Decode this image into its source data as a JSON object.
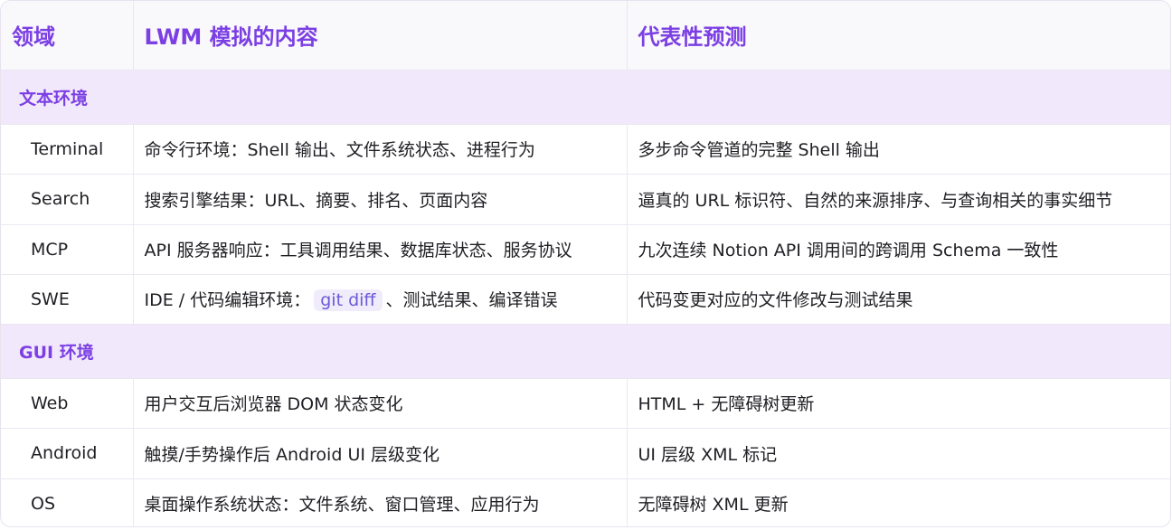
{
  "header": {
    "col1": "领域",
    "col2": "LWM 模拟的内容",
    "col3": "代表性预测"
  },
  "groups": [
    {
      "label": "文本环境",
      "rows": [
        {
          "domain": "Terminal",
          "simulates": "命令行环境：Shell 输出、文件系统状态、进程行为",
          "prediction": "多步命令管道的完整 Shell 输出"
        },
        {
          "domain": "Search",
          "simulates": "搜索引擎结果：URL、摘要、排名、页面内容",
          "prediction": "逼真的 URL 标识符、自然的来源排序、与查询相关的事实细节"
        },
        {
          "domain": "MCP",
          "simulates": "API 服务器响应：工具调用结果、数据库状态、服务协议",
          "prediction": "九次连续 Notion API 调用间的跨调用 Schema 一致性"
        },
        {
          "domain": "SWE",
          "simulates_prefix": "IDE / 代码编辑环境：",
          "simulates_code": "git diff",
          "simulates_suffix": "、测试结果、编译错误",
          "prediction": "代码变更对应的文件修改与测试结果"
        }
      ]
    },
    {
      "label": "GUI 环境",
      "rows": [
        {
          "domain": "Web",
          "simulates": "用户交互后浏览器 DOM 状态变化",
          "prediction": "HTML + 无障碍树更新"
        },
        {
          "domain": "Android",
          "simulates": "触摸/手势操作后 Android UI 层级变化",
          "prediction": "UI 层级 XML 标记"
        },
        {
          "domain": "OS",
          "simulates": "桌面操作系统状态：文件系统、窗口管理、应用行为",
          "prediction": "无障碍树 XML 更新"
        }
      ]
    }
  ],
  "colors": {
    "accent": "#7b3fe4",
    "group_bg": "#f2e8fc",
    "header_bg": "#f9f8fb",
    "code_bg": "#f0ecfb",
    "code_text": "#6a5bd8"
  }
}
